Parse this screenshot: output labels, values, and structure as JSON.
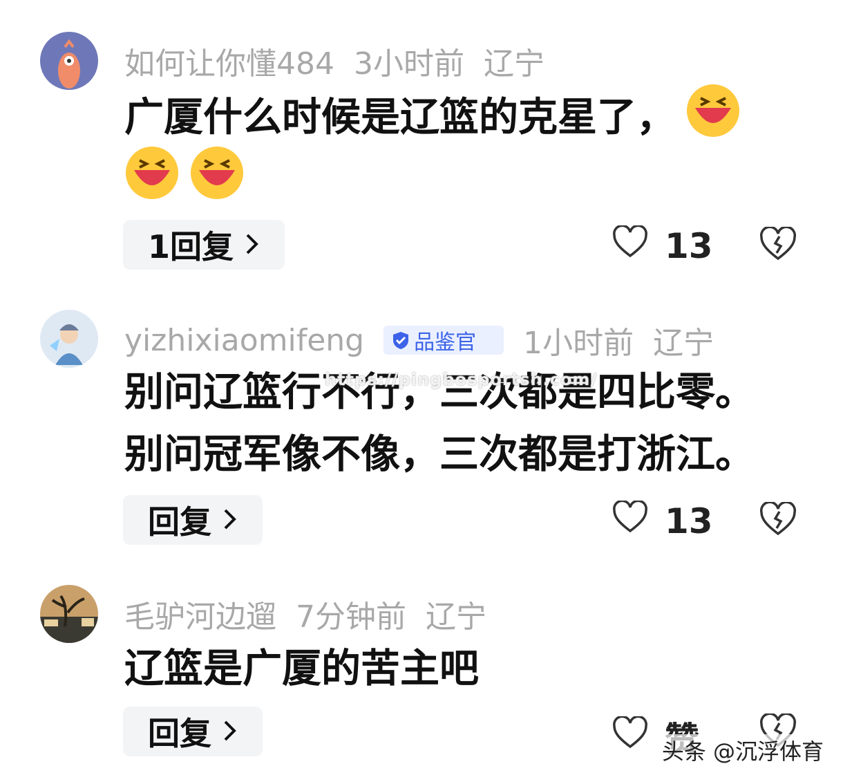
{
  "comments": [
    {
      "username": "如何让你懂484",
      "time": "3小时前",
      "location": "辽宁",
      "badge": "",
      "lines": [
        "广厦什么时候是辽篮的克星了，"
      ],
      "emoji_icon": "laughing-face-icon",
      "reply_label": "1回复",
      "likes": "13"
    },
    {
      "username": "yizhixiaomifeng",
      "time": "1小时前",
      "location": "辽宁",
      "badge": "品鉴官",
      "lines": [
        "别问辽篮行不行，三次都是四比零。",
        "别问冠军像不像，三次都是打浙江。"
      ],
      "reply_label": "回复",
      "likes": "13"
    },
    {
      "username": "毛驴河边遛",
      "time": "7分钟前",
      "location": "辽宁",
      "badge": "",
      "lines": [
        "辽篮是广厦的苦主吧"
      ],
      "reply_label": "回复",
      "likes": "赞"
    }
  ],
  "watermark": "https://pingbosportsh.com/",
  "footer": "头条 @沉浮体育",
  "colors": {
    "meta": "#a8a8a8",
    "badge_bg": "#eaf0ff",
    "badge_text": "#3c63e8",
    "reply_bg": "#f3f4f6"
  },
  "icons": {
    "like": "heart-icon",
    "dislike": "broken-heart-icon",
    "chevron": "chevron-right-icon",
    "verified": "verified-shield-icon"
  }
}
